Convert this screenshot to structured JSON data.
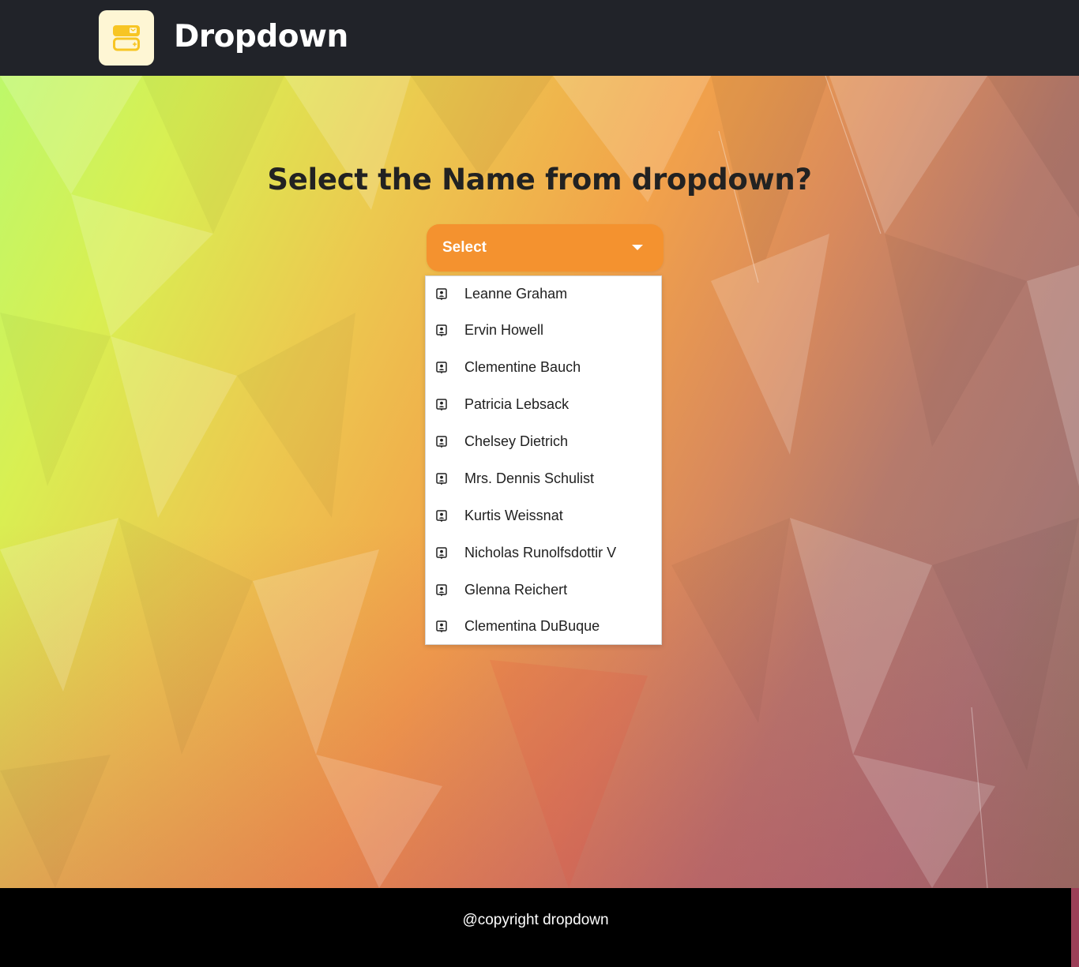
{
  "header": {
    "title": "Dropdown",
    "logo_icon": "wallet-icon",
    "background": "#212329"
  },
  "main": {
    "question": "Select the Name from dropdown?",
    "select": {
      "label": "Select",
      "accent": "#f4922f",
      "caret_icon": "caret-down-icon"
    },
    "options_icon": "contact-card-icon",
    "options": [
      "Leanne Graham",
      "Ervin Howell",
      "Clementine Bauch",
      "Patricia Lebsack",
      "Chelsey Dietrich",
      "Mrs. Dennis Schulist",
      "Kurtis Weissnat",
      "Nicholas Runolfsdottir V",
      "Glenna Reichert",
      "Clementina DuBuque"
    ]
  },
  "footer": {
    "copyright": "@copyright dropdown"
  }
}
